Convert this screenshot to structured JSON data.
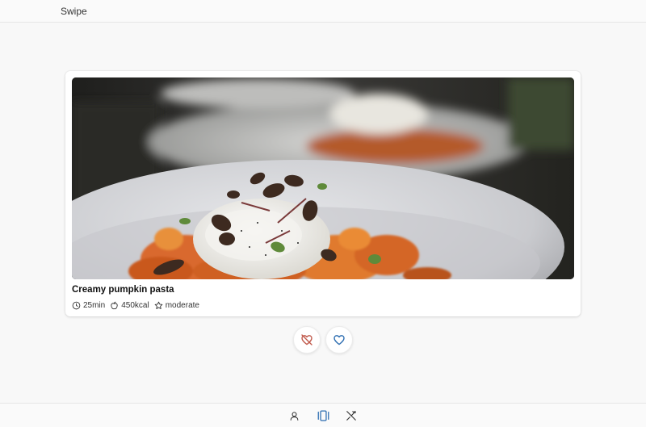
{
  "header": {
    "title": "Swipe"
  },
  "card": {
    "image_alt": "Plate of creamy pumpkin pasta topped with burrata, pumpkin seeds and microgreens",
    "title": "Creamy pumpkin pasta",
    "meta": {
      "time": "25min",
      "calories": "450kcal",
      "difficulty": "moderate"
    }
  },
  "actions": {
    "dislike_icon": "heart-off-icon",
    "like_icon": "heart-icon"
  },
  "bottom_nav": {
    "items": [
      {
        "icon": "user-icon",
        "active": false
      },
      {
        "icon": "swipe-cards-icon",
        "active": true
      },
      {
        "icon": "utensils-icon",
        "active": false
      }
    ]
  },
  "colors": {
    "accent": "#2b6cb0",
    "dislike": "#c0584a",
    "background": "#f8f8f8"
  }
}
